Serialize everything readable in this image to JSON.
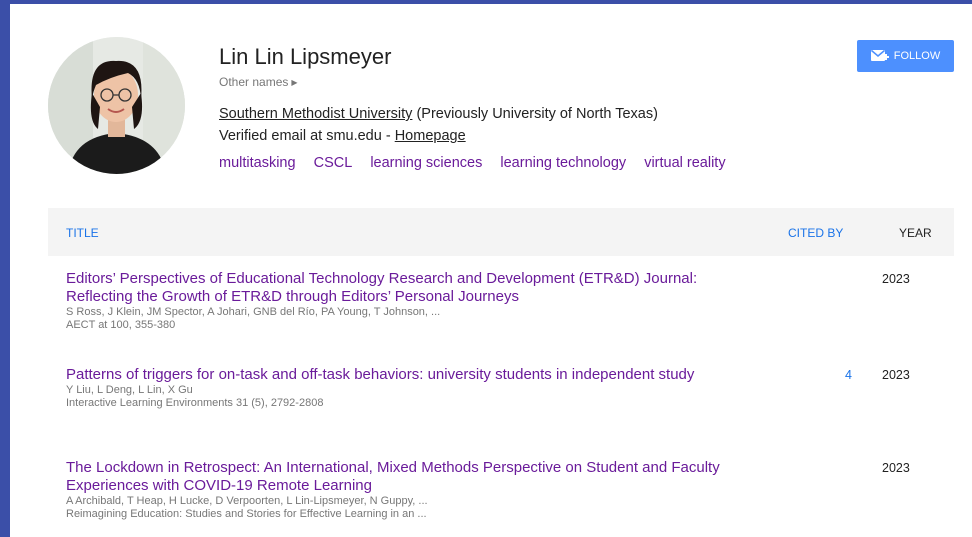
{
  "profile": {
    "name": "Lin Lin Lipsmeyer",
    "other_names": "Other names",
    "affiliation_link": "Southern Methodist University",
    "affiliation_rest": " (Previously University of North Texas)",
    "email_text": "Verified email at smu.edu - ",
    "homepage": "Homepage",
    "interests": [
      "multitasking",
      "CSCL",
      "learning sciences",
      "learning technology",
      "virtual reality"
    ]
  },
  "follow_button": {
    "label": "FOLLOW"
  },
  "table": {
    "headers": {
      "title": "TITLE",
      "cited_by": "CITED BY",
      "year": "YEAR"
    },
    "rows": [
      {
        "title": "Editors’ Perspectives of Educational Technology Research and Development (ETR&D) Journal: Reflecting the Growth of ETR&D through Editors’ Personal Journeys",
        "authors": "S Ross, J Klein, JM Spector, A Johari, GNB del Río, PA Young, T Johnson, ...",
        "venue": "AECT at 100, 355-380",
        "cited_by": "",
        "year": "2023"
      },
      {
        "title": "Patterns of triggers for on-task and off-task behaviors: university students in independent study",
        "authors": "Y Liu, L Deng, L Lin, X Gu",
        "venue": "Interactive Learning Environments 31 (5), 2792-2808",
        "cited_by": "4",
        "year": "2023"
      },
      {
        "title": "The Lockdown in Retrospect: An International, Mixed Methods Perspective on Student and Faculty Experiences with COVID-19 Remote Learning",
        "authors": "A Archibald, T Heap, H Lucke, D Verpoorten, L Lin-Lipsmeyer, N Guppy, ...",
        "venue": "Reimagining Education: Studies and Stories for Effective Learning in an ...",
        "cited_by": "",
        "year": "2023"
      }
    ]
  }
}
